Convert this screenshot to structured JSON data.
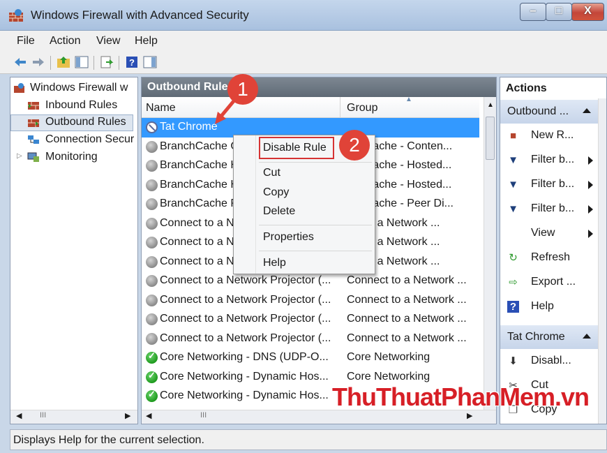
{
  "window": {
    "title": "Windows Firewall with Advanced Security"
  },
  "menubar": {
    "items": [
      "File",
      "Action",
      "View",
      "Help"
    ]
  },
  "toolbar": {
    "icons": [
      "back-icon",
      "forward-icon",
      "up-folder-icon",
      "show-hide-tree-icon",
      "export-list-icon",
      "help-icon",
      "show-hide-action-pane-icon"
    ]
  },
  "tree": {
    "root": "Windows Firewall w",
    "items": [
      "Inbound Rules",
      "Outbound Rules",
      "Connection Secur",
      "Monitoring"
    ]
  },
  "center": {
    "header": "Outbound Rules",
    "columns": {
      "name": "Name",
      "group": "Group"
    },
    "rows": [
      {
        "name": "Tat Chrome",
        "group": "",
        "status": "blocked"
      },
      {
        "name": "BranchCache C",
        "group": "nchCache - Conten...",
        "status": "disabled"
      },
      {
        "name": "BranchCache H",
        "group": "nchCache - Hosted...",
        "status": "disabled"
      },
      {
        "name": "BranchCache H",
        "group": "nchCache - Hosted...",
        "status": "disabled"
      },
      {
        "name": "BranchCache P",
        "group": "nchCache - Peer Di...",
        "status": "disabled"
      },
      {
        "name": "Connect to a N",
        "group": "ect to a Network ...",
        "status": "disabled"
      },
      {
        "name": "Connect to a N",
        "group": "ect to a Network ...",
        "status": "disabled"
      },
      {
        "name": "Connect to a N",
        "group": "ect to a Network ...",
        "status": "disabled"
      },
      {
        "name": "Connect to a Network Projector (...",
        "group": "Connect to a Network ...",
        "status": "disabled"
      },
      {
        "name": "Connect to a Network Projector (...",
        "group": "Connect to a Network ...",
        "status": "disabled"
      },
      {
        "name": "Connect to a Network Projector (...",
        "group": "Connect to a Network ...",
        "status": "disabled"
      },
      {
        "name": "Connect to a Network Projector (...",
        "group": "Connect to a Network ...",
        "status": "disabled"
      },
      {
        "name": "Core Networking - DNS (UDP-O...",
        "group": "Core Networking",
        "status": "enabled"
      },
      {
        "name": "Core Networking - Dynamic Hos...",
        "group": "Core Networking",
        "status": "enabled"
      },
      {
        "name": "Core Networking - Dynamic Hos...",
        "group": "",
        "status": "enabled"
      }
    ]
  },
  "context_menu": {
    "items": [
      "Disable Rule",
      "Cut",
      "Copy",
      "Delete",
      "Properties",
      "Help"
    ]
  },
  "actions": {
    "header": "Actions",
    "section1": "Outbound ...",
    "section1_items": [
      {
        "label": "New R...",
        "icon": "new-rule-icon",
        "submenu": false
      },
      {
        "label": "Filter b...",
        "icon": "filter-icon",
        "submenu": true
      },
      {
        "label": "Filter b...",
        "icon": "filter-icon",
        "submenu": true
      },
      {
        "label": "Filter b...",
        "icon": "filter-icon",
        "submenu": true
      },
      {
        "label": "View",
        "icon": "",
        "submenu": true
      },
      {
        "label": "Refresh",
        "icon": "refresh-icon",
        "submenu": false
      },
      {
        "label": "Export ...",
        "icon": "export-icon",
        "submenu": false
      },
      {
        "label": "Help",
        "icon": "help-icon",
        "submenu": false
      }
    ],
    "section2": "Tat Chrome",
    "section2_items": [
      {
        "label": "Disabl...",
        "icon": "disable-icon"
      },
      {
        "label": "Cut",
        "icon": "cut-icon"
      },
      {
        "label": "Copy",
        "icon": "copy-icon"
      }
    ]
  },
  "statusbar": {
    "text": "Displays Help for the current selection."
  },
  "annotations": {
    "step1": "1",
    "step2": "2",
    "watermark": "ThuThuatPhanMem.vn"
  },
  "colors": {
    "selection": "#3399ff",
    "annotation": "#e04338",
    "highlight_border": "#d63333"
  }
}
